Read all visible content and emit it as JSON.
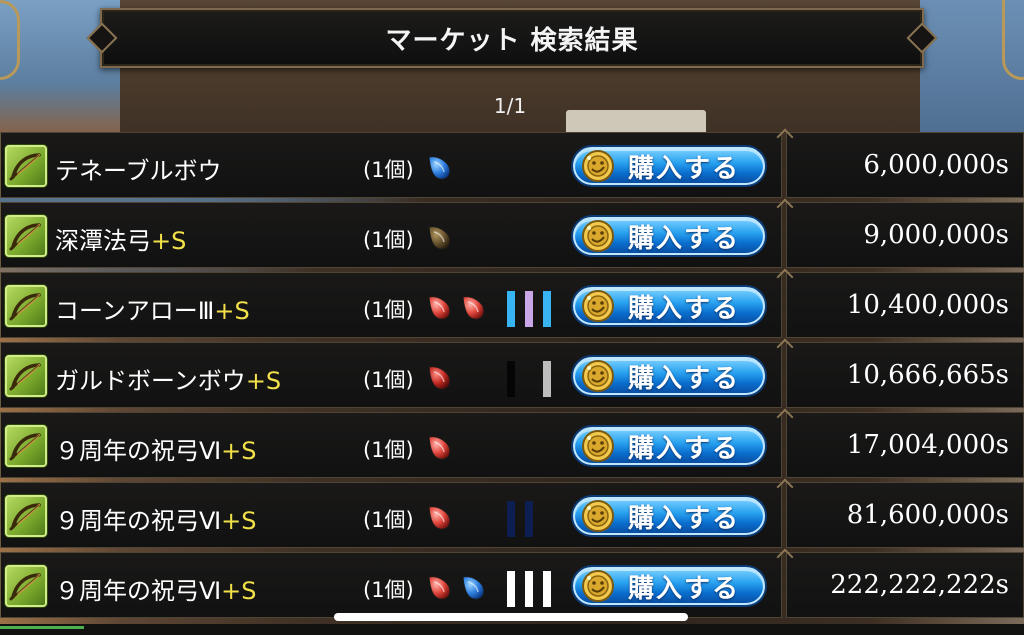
{
  "title": "マーケット 検索結果",
  "page": "1/1",
  "buy_label": "購入する",
  "qty_suffix": "s",
  "rows": [
    {
      "name": "テネーブルボウ",
      "plus": "",
      "qty": "(1個)",
      "gems": [
        "blue"
      ],
      "stripes": [],
      "price": "6,000,000s"
    },
    {
      "name": "深潭法弓",
      "plus": "+S",
      "qty": "(1個)",
      "gems": [
        "brown"
      ],
      "stripes": [],
      "price": "9,000,000s"
    },
    {
      "name": "コーンアローⅢ",
      "plus": "+S",
      "qty": "(1個)",
      "gems": [
        "red",
        "red"
      ],
      "stripes": [
        "#39b4f2",
        "#c9a6e8",
        "#39b4f2"
      ],
      "price": "10,400,000s"
    },
    {
      "name": "ガルドボーンボウ",
      "plus": "+S",
      "qty": "(1個)",
      "gems": [
        "red-dark"
      ],
      "stripes": [
        "#050505",
        "",
        "#bdbdbd"
      ],
      "price": "10,666,665s"
    },
    {
      "name": "９周年の祝弓Ⅵ",
      "plus": "+S",
      "qty": "(1個)",
      "gems": [
        "red"
      ],
      "stripes": [],
      "price": "17,004,000s"
    },
    {
      "name": "９周年の祝弓Ⅵ",
      "plus": "+S",
      "qty": "(1個)",
      "gems": [
        "red"
      ],
      "stripes": [
        "#0d1f52",
        "#0d1f52"
      ],
      "price": "81,600,000s"
    },
    {
      "name": "９周年の祝弓Ⅵ",
      "plus": "+S",
      "qty": "(1個)",
      "gems": [
        "red",
        "blue"
      ],
      "stripes": [
        "#ffffff",
        "#ffffff",
        "#ffffff"
      ],
      "price": "222,222,222s"
    }
  ],
  "colors": {
    "gem_blue": "#3a8fe8",
    "gem_red": "#d8403a",
    "gem_brown": "#6a5530",
    "button_blue": "#1f8ee6",
    "plus_yellow": "#f3e14a",
    "icon_green": "#8cbf3a"
  },
  "icons": {
    "item": "bow-icon",
    "coin": "gold-coin-icon"
  }
}
